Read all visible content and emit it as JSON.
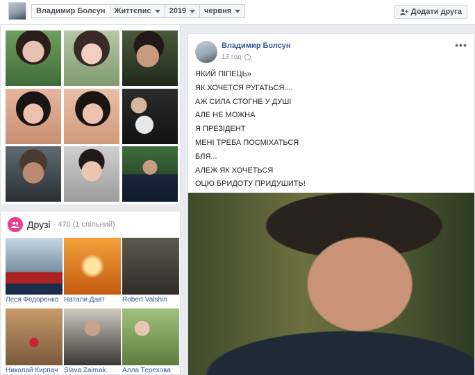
{
  "top_bar": {
    "profile_name": "Владимир Болсун",
    "tabs": [
      "Життєпис",
      "2019",
      "червня"
    ],
    "add_friend_label": "Додати друга"
  },
  "friends": {
    "title": "Друзі",
    "count": "· 470 (1 спільний)",
    "list": [
      {
        "name": "Леся Федоренко"
      },
      {
        "name": "Натали Давт"
      },
      {
        "name": "Robert Valshin"
      },
      {
        "name": "Николай Кирпач"
      },
      {
        "name": "Slava Zaimak"
      },
      {
        "name": "Алла Терехова"
      }
    ]
  },
  "post": {
    "author": "Владимир Болсун",
    "time": "13 год",
    "lines": [
      "ЯКИЙ ПІПЕЦЬ»",
      "ЯК ХОЧЕТСЯ РУГАТЬСЯ....",
      "АЖ СИЛА СТОГНЕ У ДУШІ",
      "АЛЕ НЕ МОЖНА",
      "Я ПРЕЗІДЕНТ",
      "МЕНІ ТРЕБА ПОСМІХАТЬСЯ",
      "БЛЯ...",
      "АЛЕЖ ЯК ХОЧЕТЬСЯ",
      "ОЦЮ БРИДОТУ ПРИДУШИТЬ!"
    ],
    "more_label": "•••"
  }
}
